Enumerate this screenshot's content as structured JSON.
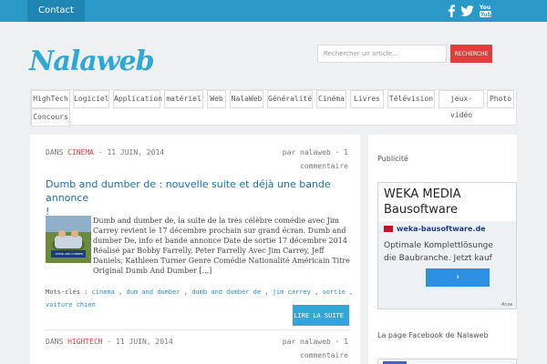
{
  "topbar": {
    "contact_label": "Contact"
  },
  "header": {
    "logo_text": "Nalaweb",
    "search": {
      "placeholder": "Rechercher un article...",
      "button_label": "RECHERCHE"
    }
  },
  "nav": {
    "items": [
      "HighTech",
      "Logiciel",
      "Application",
      "matériel",
      "Web",
      "NalaWeb",
      "Généralité",
      "Cinéma",
      "Livres",
      "Télévision",
      "jeux-vidéo",
      "Photo",
      "Concours"
    ]
  },
  "posts": [
    {
      "dans": "DANS",
      "category": "CINÉMA",
      "date": "- 11 JUIN, 2014",
      "author_line1": "par nalaweb · 1",
      "author_line2": "commentaire",
      "title_line1": "Dumb and dumber de : nouvelle suite et déjà une bande annonce",
      "title_line2": "!",
      "excerpt_lines": [
        "Dumb and dumber de, la suite de la très célèbre comédie avec Jim",
        "Carrey revient le 17 décembre prochain sur grand écran. Dumb and",
        "dumber De, info et bande annonce Date de sortie 17 décembre 2014",
        "Réalisé par Bobby Farrelly, Peter Farrelly Avec Jim Carrey, Jeff",
        "Daniels, Kathleen Turner Genre Comédie Nationalité Américain Titre",
        "Original Dumb And Dumber [...]"
      ],
      "thumb_caption": "DUMB AND DUMBER",
      "tags_label": "Mots-clés :",
      "tags": [
        "cinema",
        "dum and dumber",
        "dumb and dumber de",
        "jim carrey",
        "sortie",
        "voiture chien"
      ],
      "read_more_label": "LIRE LA SUITE"
    },
    {
      "dans": "DANS",
      "category": "HIGHTECH",
      "date": "- 11 JUIN, 2014",
      "author_line1": "par nalaweb · 1",
      "author_line2": "commentaire"
    }
  ],
  "sidebar": {
    "pub_title": "Publicité",
    "ad": {
      "headline_line1": "WEKA MEDIA",
      "headline_line2": "Bausoftware",
      "domain": "weka-bausoftware.de",
      "text_line1": "Optimale Komplettlösunge",
      "text_line2": "die Baubranche. Jetzt kauf",
      "button_glyph": "›",
      "badge": "Anze"
    },
    "facebook_title": "La page Facebook de Nalaweb"
  },
  "colors": {
    "brand_blue": "#2b99c7",
    "accent_red": "#e23e3e",
    "link_blue": "#1d6fa5"
  },
  "icons": [
    "facebook-icon",
    "twitter-icon",
    "youtube-icon",
    "search-button"
  ]
}
